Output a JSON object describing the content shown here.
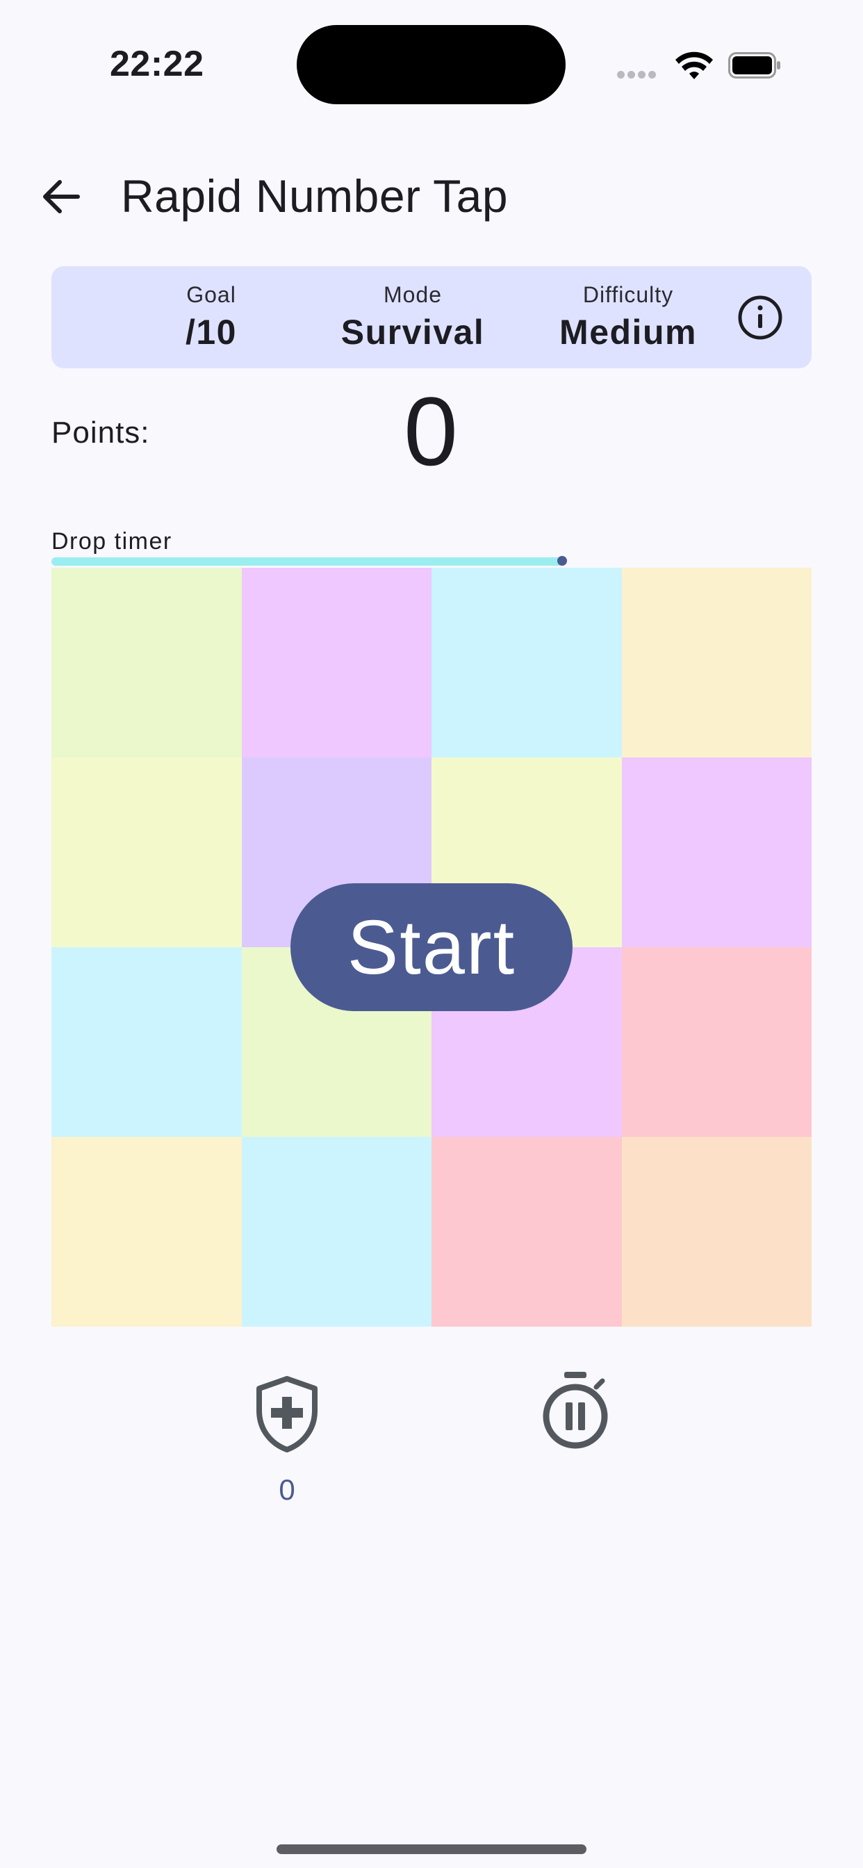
{
  "status_bar": {
    "time": "22:22"
  },
  "header": {
    "title": "Rapid Number Tap",
    "back_icon": "arrow-left-icon"
  },
  "info_card": {
    "goal": {
      "label": "Goal",
      "value": "/10"
    },
    "mode": {
      "label": "Mode",
      "value": "Survival"
    },
    "difficulty": {
      "label": "Difficulty",
      "value": "Medium"
    },
    "info_icon": "info-circle-icon"
  },
  "points": {
    "label": "Points:",
    "value": "0"
  },
  "drop_timer": {
    "label": "Drop timer",
    "progress": 0.67,
    "color": "#9aeef0"
  },
  "grid": {
    "tiles": [
      "#eaf8cc",
      "#eec8ff",
      "#ccf4ff",
      "#fbf1cc",
      "#f4f9cc",
      "#dccaff",
      "#f4f9cc",
      "#eec8ff",
      "#ccf4ff",
      "#eaf8cc",
      "#eec8ff",
      "#fdc8cf",
      "#fcf2cc",
      "#ccf4ff",
      "#fdc8cf",
      "#fde0c8"
    ]
  },
  "start_button": {
    "label": "Start",
    "color": "#4b5b91"
  },
  "power_ups": {
    "shield": {
      "icon": "shield-plus-icon",
      "count": "0"
    },
    "stopwatch": {
      "icon": "stopwatch-pause-icon"
    }
  }
}
